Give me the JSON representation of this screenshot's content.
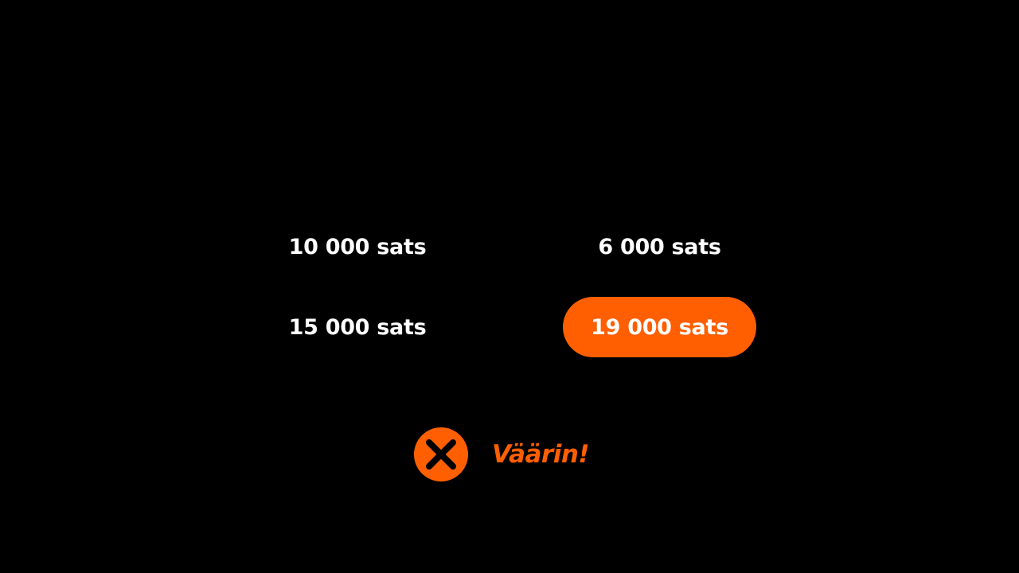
{
  "quiz": {
    "options": [
      {
        "label": "10 000 sats",
        "selected": false
      },
      {
        "label": "6 000 sats",
        "selected": false
      },
      {
        "label": "15 000 sats",
        "selected": false
      },
      {
        "label": "19 000 sats",
        "selected": true
      }
    ]
  },
  "feedback": {
    "icon": "close-circle-icon",
    "text": "Väärin!",
    "status": "incorrect"
  },
  "colors": {
    "background": "#000000",
    "accent": "#ff5f00",
    "text": "#ffffff"
  }
}
